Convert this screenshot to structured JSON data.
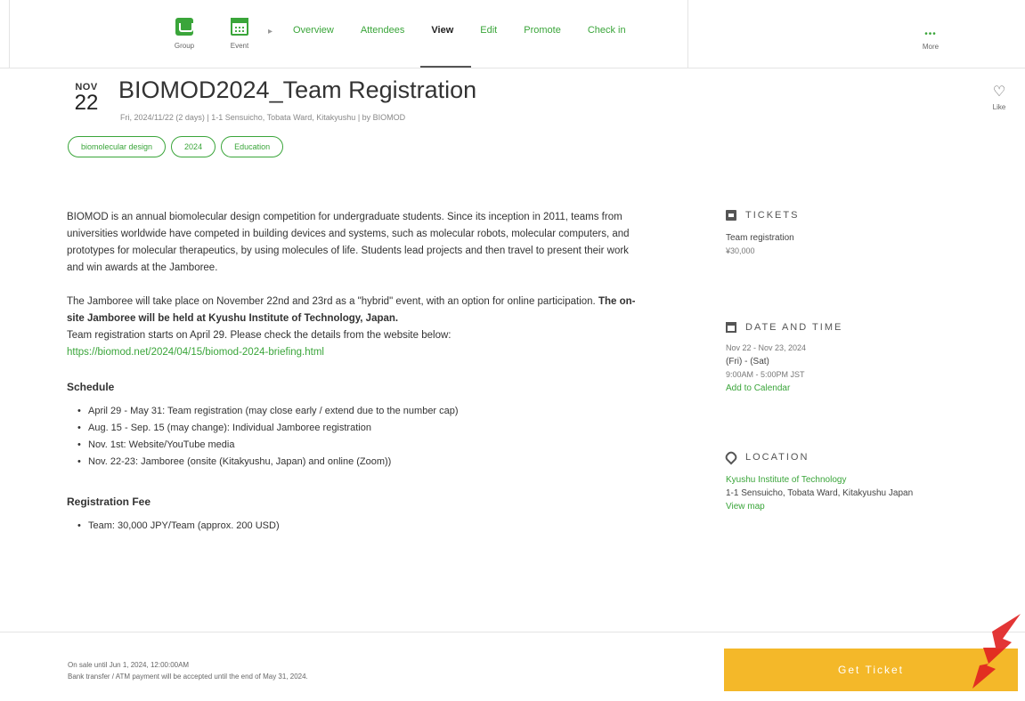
{
  "nav": {
    "group_label": "Group",
    "event_label": "Event",
    "tabs": [
      {
        "label": "Overview",
        "active": false
      },
      {
        "label": "Attendees",
        "active": false
      },
      {
        "label": "View",
        "active": true
      },
      {
        "label": "Edit",
        "active": false
      },
      {
        "label": "Promote",
        "active": false
      },
      {
        "label": "Check in",
        "active": false
      }
    ],
    "more_label": "More"
  },
  "event": {
    "month": "NOV",
    "day": "22",
    "title": "BIOMOD2024_Team Registration",
    "subtitle": "Fri, 2024/11/22 (2 days) | 1-1 Sensuicho, Tobata Ward, Kitakyushu | by BIOMOD",
    "tags": [
      "biomolecular design",
      "2024",
      "Education"
    ],
    "like_label": "Like"
  },
  "description": {
    "p1": "BIOMOD is an annual biomolecular design competition for undergraduate students. Since its inception in 2011, teams from universities worldwide have competed in building devices and systems, such as molecular robots, molecular computers, and prototypes for molecular therapeutics, by using molecules of life. Students lead projects and then travel to present their work and win awards at the Jamboree.",
    "p2_start": "The Jamboree will take place on November 22nd and 23rd as a \"hybrid\" event, with an option for online participation. ",
    "p2_bold": "The on-site Jamboree will be held at Kyushu Institute of Technology, Japan.",
    "p3": "Team registration starts on April 29. Please check the details from the website below:",
    "link": "https://biomod.net/2024/04/15/biomod-2024-briefing.html",
    "schedule_title": "Schedule",
    "schedule": [
      "April 29 - May 31: Team registration (may close early / extend due to the number cap)",
      "Aug. 15 - Sep. 15 (may change): Individual Jamboree registration",
      "Nov. 1st: Website/YouTube media",
      "Nov. 22-23: Jamboree (onsite (Kitakyushu, Japan) and online (Zoom))"
    ],
    "fee_title": "Registration Fee",
    "fees": [
      "Team: 30,000 JPY/Team (approx. 200 USD)"
    ]
  },
  "sidebar": {
    "tickets_head": "TICKETS",
    "ticket_name": "Team registration",
    "ticket_price": "¥30,000",
    "date_head": "DATE AND TIME",
    "date_range": "Nov 22 - Nov 23, 2024",
    "date_days": "(Fri) - (Sat)",
    "date_time": "9:00AM - 5:00PM JST",
    "add_calendar": "Add to Calendar",
    "location_head": "LOCATION",
    "location_name": "Kyushu Institute of Technology",
    "location_address": "1-1 Sensuicho, Tobata Ward, Kitakyushu Japan",
    "view_map": "View map"
  },
  "bottom": {
    "note1": "On sale until Jun 1, 2024, 12:00:00AM",
    "note2": "Bank transfer / ATM payment will be accepted until the end of May 31, 2024.",
    "button": "Get Ticket"
  },
  "colors": {
    "accent": "#3aa53a",
    "button": "#f4b829",
    "annotation": "#e02020"
  }
}
